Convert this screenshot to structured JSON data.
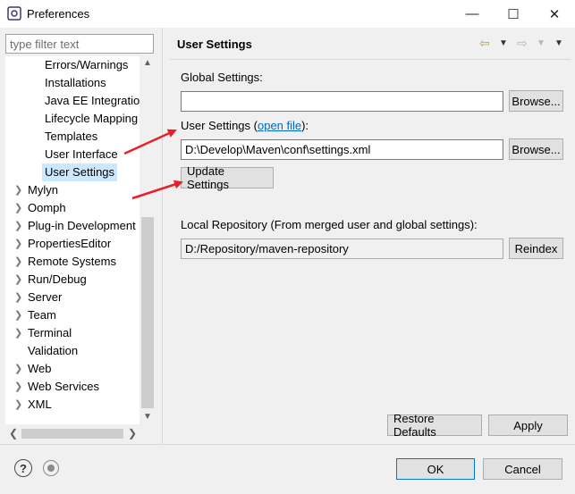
{
  "window": {
    "title": "Preferences",
    "minimize": "—",
    "maximize": "☐",
    "close": "✕"
  },
  "filter": {
    "placeholder": "type filter text"
  },
  "tree": {
    "children": [
      {
        "label": "Errors/Warnings"
      },
      {
        "label": "Installations"
      },
      {
        "label": "Java EE Integration"
      },
      {
        "label": "Lifecycle Mapping"
      },
      {
        "label": "Templates"
      },
      {
        "label": "User Interface"
      },
      {
        "label": "User Settings",
        "selected": true
      }
    ],
    "top_items": [
      {
        "label": "Mylyn",
        "expandable": true
      },
      {
        "label": "Oomph",
        "expandable": true
      },
      {
        "label": "Plug-in Development",
        "expandable": true
      },
      {
        "label": "PropertiesEditor",
        "expandable": true
      },
      {
        "label": "Remote Systems",
        "expandable": true
      },
      {
        "label": "Run/Debug",
        "expandable": true
      },
      {
        "label": "Server",
        "expandable": true
      },
      {
        "label": "Team",
        "expandable": true
      },
      {
        "label": "Terminal",
        "expandable": true
      },
      {
        "label": "Validation",
        "expandable": false
      },
      {
        "label": "Web",
        "expandable": true
      },
      {
        "label": "Web Services",
        "expandable": true
      },
      {
        "label": "XML",
        "expandable": true
      }
    ]
  },
  "page": {
    "title": "User Settings",
    "global_label": "Global Settings:",
    "global_value": "",
    "browse_label": "Browse...",
    "user_label_prefix": "User Settings (",
    "user_label_link": "open file",
    "user_label_suffix": "):",
    "user_value": "D:\\Develop\\Maven\\conf\\settings.xml",
    "update_label": "Update Settings",
    "local_repo_label": "Local Repository (From merged user and global settings):",
    "local_repo_value": "D:/Repository/maven-repository",
    "reindex_label": "Reindex",
    "restore_label": "Restore Defaults",
    "apply_label": "Apply"
  },
  "footer": {
    "ok_label": "OK",
    "cancel_label": "Cancel",
    "help_glyph": "?"
  },
  "colors": {
    "annotation_arrow": "#e8202a",
    "selection": "#cce8ff",
    "link": "#0066cc"
  }
}
